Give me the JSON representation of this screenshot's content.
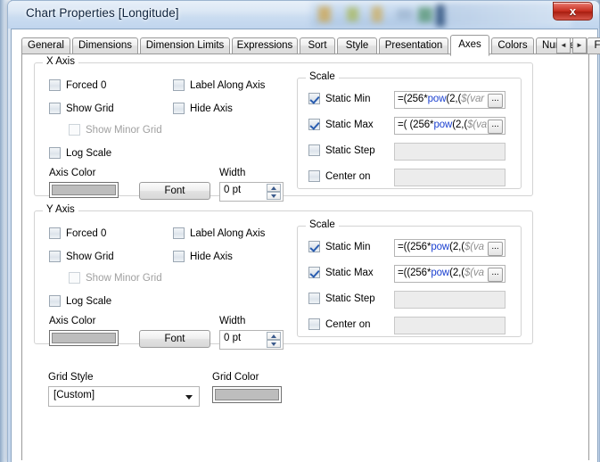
{
  "window": {
    "title": "Chart Properties [Longitude]",
    "close_label": "x"
  },
  "tabs": [
    {
      "label": "General",
      "selected": false
    },
    {
      "label": "Dimensions",
      "selected": false
    },
    {
      "label": "Dimension Limits",
      "selected": false
    },
    {
      "label": "Expressions",
      "selected": false
    },
    {
      "label": "Sort",
      "selected": false
    },
    {
      "label": "Style",
      "selected": false
    },
    {
      "label": "Presentation",
      "selected": false
    },
    {
      "label": "Axes",
      "selected": true
    },
    {
      "label": "Colors",
      "selected": false
    },
    {
      "label": "Number",
      "selected": false
    },
    {
      "label": "Font",
      "selected": false
    }
  ],
  "tab_nav": {
    "prev": "◄",
    "next": "►"
  },
  "x_axis": {
    "group_label": "X Axis",
    "checkboxes": [
      {
        "label": "Forced 0",
        "checked": false,
        "disabled": false
      },
      {
        "label": "Show Grid",
        "checked": false,
        "disabled": false
      },
      {
        "label": "Show Minor Grid",
        "checked": false,
        "disabled": true
      },
      {
        "label": "Log Scale",
        "checked": false,
        "disabled": false
      },
      {
        "label": "Label Along Axis",
        "checked": false,
        "disabled": false
      },
      {
        "label": "Hide Axis",
        "checked": false,
        "disabled": false
      }
    ],
    "axis_color_label": "Axis Color",
    "axis_color_value": "#bdbdbd",
    "font_button": "Font",
    "width_label": "Width",
    "width_value": "0 pt",
    "scale": {
      "group_label": "Scale",
      "rows": [
        {
          "label": "Static Min",
          "checked": true,
          "enabled": true,
          "expr_plain": "=(256*pow(2,($(var",
          "expr_pre": "=(256*",
          "expr_fn": "pow",
          "expr_mid": "(2,(",
          "expr_var": "$(var"
        },
        {
          "label": "Static Max",
          "checked": true,
          "enabled": true,
          "expr_plain": "=( (256*pow(2,($(va",
          "expr_pre": "=( (256*",
          "expr_fn": "pow",
          "expr_mid": "(2,(",
          "expr_var": "$(va"
        },
        {
          "label": "Static Step",
          "checked": false,
          "enabled": false,
          "expr_plain": "",
          "expr_pre": "",
          "expr_fn": "",
          "expr_mid": "",
          "expr_var": ""
        },
        {
          "label": "Center on",
          "checked": false,
          "enabled": false,
          "expr_plain": "",
          "expr_pre": "",
          "expr_fn": "",
          "expr_mid": "",
          "expr_var": ""
        }
      ],
      "browse_button": "..."
    }
  },
  "y_axis": {
    "group_label": "Y Axis",
    "checkboxes": [
      {
        "label": "Forced 0",
        "checked": false,
        "disabled": false
      },
      {
        "label": "Show Grid",
        "checked": false,
        "disabled": false
      },
      {
        "label": "Show Minor Grid",
        "checked": false,
        "disabled": true
      },
      {
        "label": "Log Scale",
        "checked": false,
        "disabled": false
      },
      {
        "label": "Label Along Axis",
        "checked": false,
        "disabled": false
      },
      {
        "label": "Hide Axis",
        "checked": false,
        "disabled": false
      }
    ],
    "axis_color_label": "Axis Color",
    "axis_color_value": "#bdbdbd",
    "font_button": "Font",
    "width_label": "Width",
    "width_value": "0 pt",
    "scale": {
      "group_label": "Scale",
      "rows": [
        {
          "label": "Static Min",
          "checked": true,
          "enabled": true,
          "expr_plain": "=((256*pow(2,($(va",
          "expr_pre": "=((256*",
          "expr_fn": "pow",
          "expr_mid": "(2,(",
          "expr_var": "$(va"
        },
        {
          "label": "Static Max",
          "checked": true,
          "enabled": true,
          "expr_plain": "=((256*pow(2,($(va",
          "expr_pre": "=((256*",
          "expr_fn": "pow",
          "expr_mid": "(2,(",
          "expr_var": "$(va"
        },
        {
          "label": "Static Step",
          "checked": false,
          "enabled": false,
          "expr_plain": "",
          "expr_pre": "",
          "expr_fn": "",
          "expr_mid": "",
          "expr_var": ""
        },
        {
          "label": "Center on",
          "checked": false,
          "enabled": false,
          "expr_plain": "",
          "expr_pre": "",
          "expr_fn": "",
          "expr_mid": "",
          "expr_var": ""
        }
      ],
      "browse_button": "..."
    }
  },
  "bottom": {
    "grid_style_label": "Grid Style",
    "grid_style_value": "[Custom]",
    "grid_color_label": "Grid Color",
    "grid_color_value": "#bdbdbd"
  }
}
